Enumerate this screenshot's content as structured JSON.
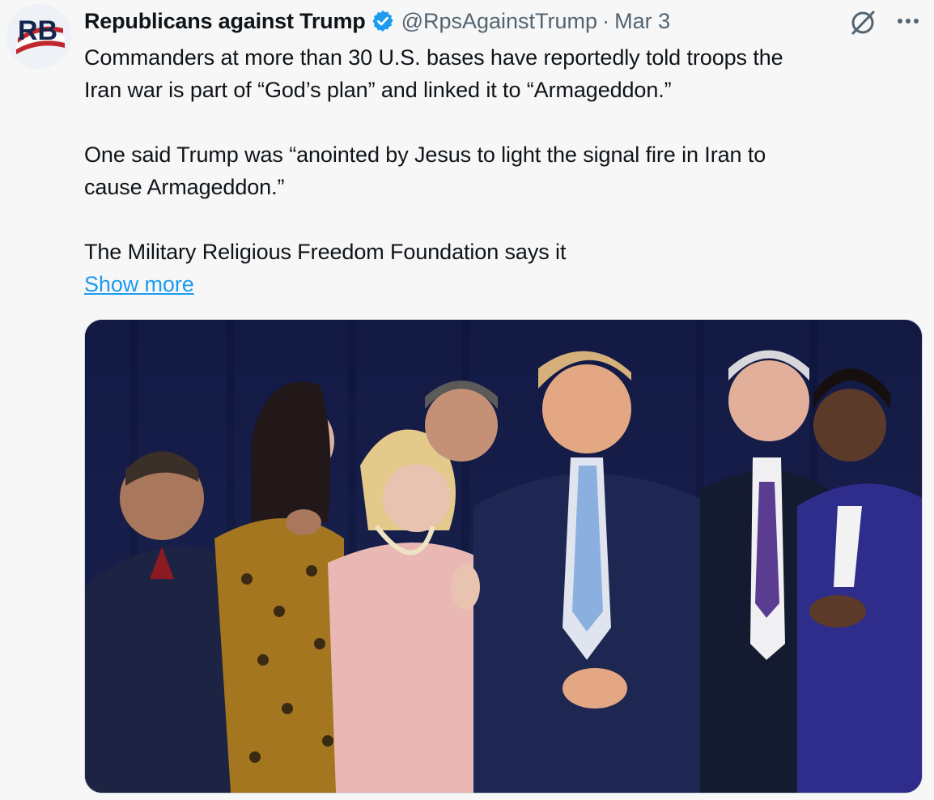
{
  "author": {
    "display_name": "Republicans against Trump",
    "handle": "@RpsAgainstTrump",
    "separator": "·",
    "date": "Mar 3",
    "avatar_initials": "RB",
    "verified_icon": "verified-badge-icon"
  },
  "actions": {
    "grok_icon": "grok-icon",
    "more_icon": "more-options-icon"
  },
  "tweet": {
    "paragraph1_line1": "Commanders at more than 30 U.S. bases have reportedly told troops the",
    "paragraph1_line2": "Iran war is part of “God’s plan” and linked it to “Armageddon.”",
    "paragraph2_line1": "One said Trump was “anointed by Jesus to light the signal fire in Iran to",
    "paragraph2_line2": "cause Armageddon.”",
    "paragraph3_line1": "The Military Religious Freedom Foundation says it",
    "show_more": "Show more"
  },
  "colors": {
    "link": "#1d9bf0",
    "verified": "#1d9bf0",
    "secondary_text": "#536471",
    "background": "#f7f7f7"
  }
}
